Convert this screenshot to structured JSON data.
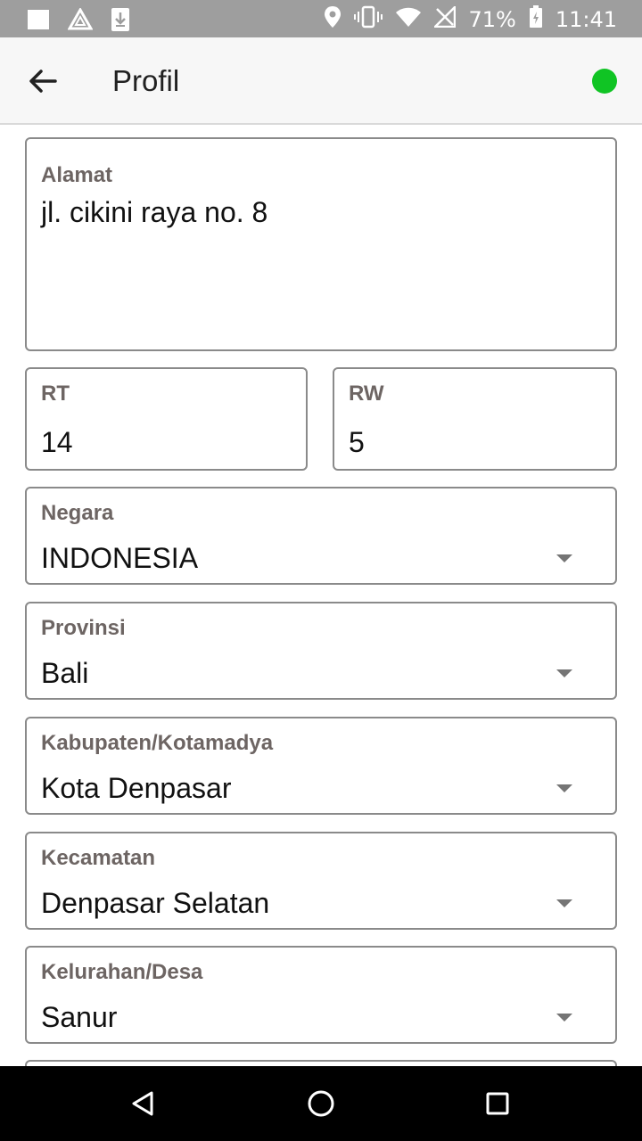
{
  "status_bar": {
    "battery": "71%",
    "time": "11:41",
    "left_icons": [
      "gallery-icon",
      "drive-icon",
      "download-icon"
    ],
    "right_icons": [
      "location-icon",
      "vibrate-icon",
      "wifi-icon",
      "no-signal-icon",
      "battery-icon"
    ]
  },
  "header": {
    "title": "Profil",
    "status_color": "#10c424"
  },
  "form": {
    "alamat": {
      "label": "Alamat",
      "value": "jl. cikini raya no. 8"
    },
    "rt": {
      "label": "RT",
      "value": "14"
    },
    "rw": {
      "label": "RW",
      "value": "5"
    },
    "negara": {
      "label": "Negara",
      "value": "INDONESIA"
    },
    "provinsi": {
      "label": "Provinsi",
      "value": "Bali"
    },
    "kabupaten": {
      "label": "Kabupaten/Kotamadya",
      "value": "Kota Denpasar"
    },
    "kecamatan": {
      "label": "Kecamatan",
      "value": "Denpasar Selatan"
    },
    "kelurahan": {
      "label": "Kelurahan/Desa",
      "value": "Sanur"
    }
  },
  "nav": [
    "back-triangle-icon",
    "home-circle-icon",
    "recents-square-icon"
  ]
}
